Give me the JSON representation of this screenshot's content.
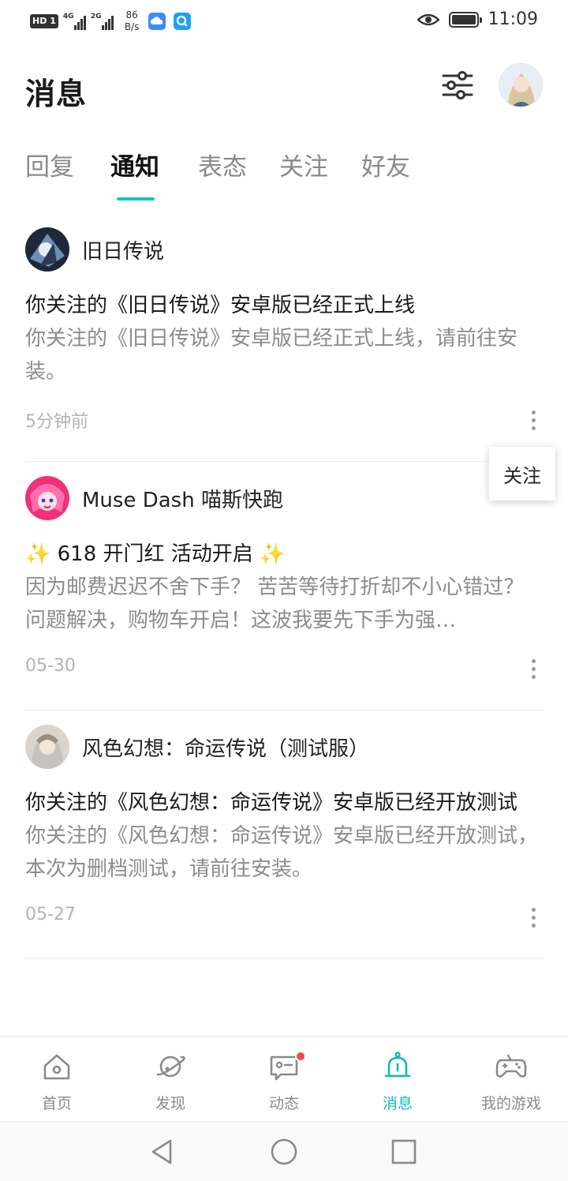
{
  "status_bar": {
    "hd": "HD",
    "sim": "1",
    "net1": "4G",
    "net2": "2G",
    "speed_value": "86",
    "speed_unit": "B/s",
    "time": "11:09"
  },
  "header": {
    "title": "消息"
  },
  "tabs": [
    {
      "label": "回复",
      "active": false
    },
    {
      "label": "通知",
      "active": true
    },
    {
      "label": "表态",
      "active": false
    },
    {
      "label": "关注",
      "active": false
    },
    {
      "label": "好友",
      "active": false
    }
  ],
  "notifications": [
    {
      "name": "旧日传说",
      "title": "你关注的《旧日传说》安卓版已经正式上线",
      "body": "你关注的《旧日传说》安卓版已经正式上线，请前往安装。",
      "time": "5分钟前"
    },
    {
      "name": "Muse Dash 喵斯快跑",
      "title": "618 开门红 活动开启",
      "body": "因为邮费迟迟不舍下手？ 苦苦等待打折却不小心错过？ 问题解决，购物车开启！这波我要先下手为强…",
      "time": "05-30"
    },
    {
      "name": "风色幻想：命运传说（测试服）",
      "title": "你关注的《风色幻想：命运传说》安卓版已经开放测试",
      "body": "你关注的《风色幻想：命运传说》安卓版已经开放测试，本次为删档测试，请前往安装。",
      "time": "05-27"
    }
  ],
  "popup": {
    "label": "关注"
  },
  "bottom_nav": [
    {
      "label": "首页",
      "icon": "home-icon",
      "active": false
    },
    {
      "label": "发现",
      "icon": "planet-icon",
      "active": false
    },
    {
      "label": "动态",
      "icon": "chat-icon",
      "active": false,
      "badge": true
    },
    {
      "label": "消息",
      "icon": "bell-icon",
      "active": true
    },
    {
      "label": "我的游戏",
      "icon": "gamepad-icon",
      "active": false
    }
  ],
  "colors": {
    "accent": "#14c3c9",
    "badge": "#f04a4a",
    "muted_text": "#8c8c8c"
  }
}
